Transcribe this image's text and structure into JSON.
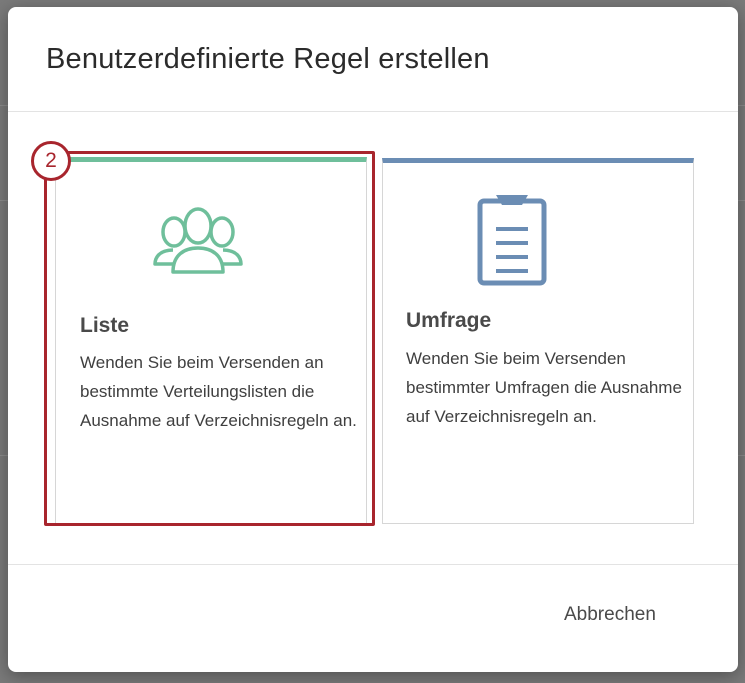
{
  "dialog": {
    "title": "Benutzerdefinierte Regel erstellen",
    "cancel_label": "Abbrechen"
  },
  "annotation": {
    "step_number": "2",
    "color": "#a8252d"
  },
  "cards": {
    "list": {
      "title": "Liste",
      "description": "Wenden Sie beim Versenden an bestimmte Verteilungslisten die Ausnahme auf Verzeichnisregeln an.",
      "icon": "users-group-icon",
      "accent_color": "#6fbf9b"
    },
    "survey": {
      "title": "Umfrage",
      "description": "Wenden Sie beim Versenden bestimmter Umfragen die Ausnahme auf Verzeichnisregeln an.",
      "icon": "clipboard-icon",
      "accent_color": "#6b8db4"
    }
  }
}
